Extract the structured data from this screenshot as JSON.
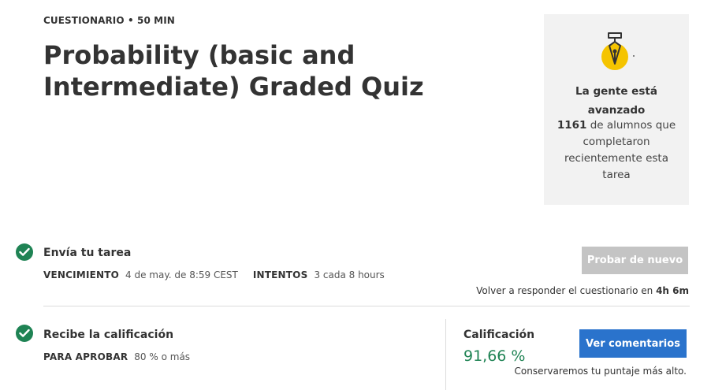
{
  "header": {
    "meta": "CUESTIONARIO • 50 MIN",
    "title": "Probability (basic and Intermediate) Graded Quiz"
  },
  "progress_card": {
    "icon": "pen-nib-icon",
    "heading": "La gente está avanzado",
    "count": "1161",
    "body": " de alumnos que completaron recientemente esta tarea"
  },
  "submit_step": {
    "title": "Envía tu tarea",
    "due_label": "VENCIMIENTO",
    "due_value": "4 de may. de 8:59 CEST",
    "attempts_label": "INTENTOS",
    "attempts_value": "3 cada 8 hours",
    "retry_button": "Probar de nuevo",
    "retry_note_prefix": "Volver a responder el cuestionario en ",
    "retry_note_time": "4h 6m"
  },
  "grade_step": {
    "title": "Recibe la calificación",
    "pass_label": "PARA APROBAR",
    "pass_value": "80 % o más",
    "grade_label": "Calificación",
    "grade_value": "91,66 %",
    "feedback_button": "Ver comentarios",
    "keep_note": "Conservaremos tu puntaje más alto."
  },
  "colors": {
    "check_green": "#1f8354",
    "grade_green": "#1f8354",
    "primary_blue": "#2a73cc",
    "disabled_gray": "#c4c4c4",
    "card_bg": "#f2f2f2",
    "icon_yellow": "#f5c400"
  }
}
